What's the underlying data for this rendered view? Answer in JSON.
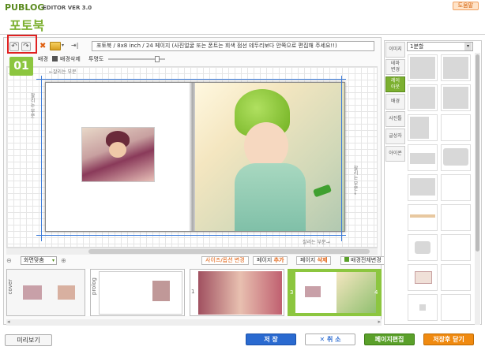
{
  "header": {
    "logo": "PUBLOG",
    "version": "EDITOR VER 3.0",
    "help_label": "도움말",
    "page_title": "포토북"
  },
  "toolbar": {
    "instructions": "포토북 / 8x8 inch / 24 페이지 (사진얼굴 또는 폰트는 회색 점선 테두리보다 안쪽으로 편집해 주세요!!)",
    "background_label": "배경",
    "delete_background_label": "배경삭제",
    "opacity_label": "투명도"
  },
  "canvas": {
    "step_badge": "01",
    "cut_top": "←잘리는 부분",
    "cut_left": "잘리는 부분",
    "cut_right": "잘리는 부분→",
    "cut_bottom": "잘리는 부분→"
  },
  "page_controls": {
    "zoom_value": "화면맞춤",
    "size_cover_change": "사이즈/옵션 변경",
    "page_label_1": "페이지",
    "page_add": "추가",
    "page_label_2": "페이지",
    "page_delete": "삭제",
    "full_bg_change": "배경전체변경"
  },
  "thumbnails": [
    {
      "label": "cover"
    },
    {
      "label": "prolog"
    },
    {
      "label": "1"
    },
    {
      "label": "3"
    },
    {
      "label": "4"
    }
  ],
  "buttons": {
    "preview": "미리보기",
    "save": "저 장",
    "cancel": "✕ 취 소",
    "page_edit": "페이지편집",
    "save_close": "저장후 닫기"
  },
  "right_panel": {
    "tabs": [
      "이미지",
      "테마\n변경",
      "레이\n아웃",
      "배경",
      "사진틀",
      "글상자",
      "아이콘"
    ],
    "active_tab": 2,
    "layout_select": "1분할"
  },
  "colors": {
    "brand_green": "#7cb030",
    "save_blue": "#2a6ad0",
    "page_edit_green": "#5aa02a",
    "save_close_orange": "#f08a10",
    "highlight_red": "#e02020"
  }
}
